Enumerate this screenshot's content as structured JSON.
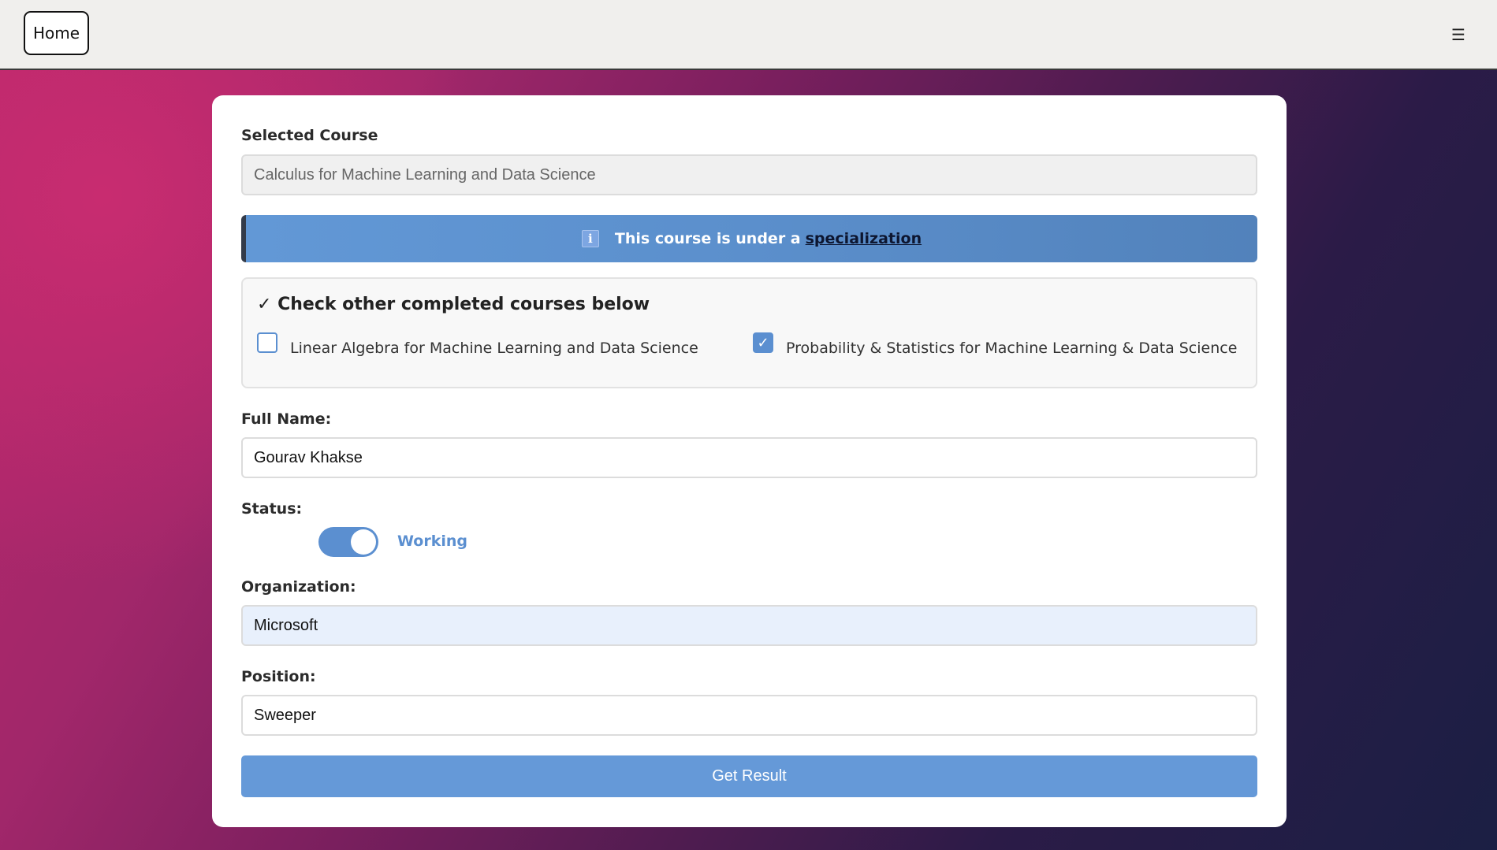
{
  "nav": {
    "home_label": "Home",
    "menu_icon": "hamburger-icon",
    "menu_glyph": "☰"
  },
  "form": {
    "selected_course": {
      "label": "Selected Course",
      "value": "Calculus for Machine Learning and Data Science"
    },
    "info": {
      "icon": "info-icon",
      "icon_glyph": "i",
      "text": "This course is under a",
      "link_text": "specialization"
    },
    "completed_courses": {
      "title": "✓ Check other completed courses below",
      "options": [
        {
          "label": "Linear Algebra for Machine Learning and Data Science",
          "checked": false
        },
        {
          "label": "Probability & Statistics for Machine Learning & Data Science",
          "checked": true
        }
      ],
      "check_glyph": "✓"
    },
    "full_name": {
      "label": "Full Name:",
      "value": "Gourav Khakse"
    },
    "status": {
      "label": "Status:",
      "toggle_on": true,
      "toggle_label": "Working"
    },
    "organization": {
      "label": "Organization:",
      "value": "Microsoft"
    },
    "position": {
      "label": "Position:",
      "value": "Sweeper"
    },
    "submit_label": "Get Result"
  },
  "colors": {
    "accent": "#5b8fd0",
    "button": "#6599d8",
    "topbar": "#f0efed"
  }
}
